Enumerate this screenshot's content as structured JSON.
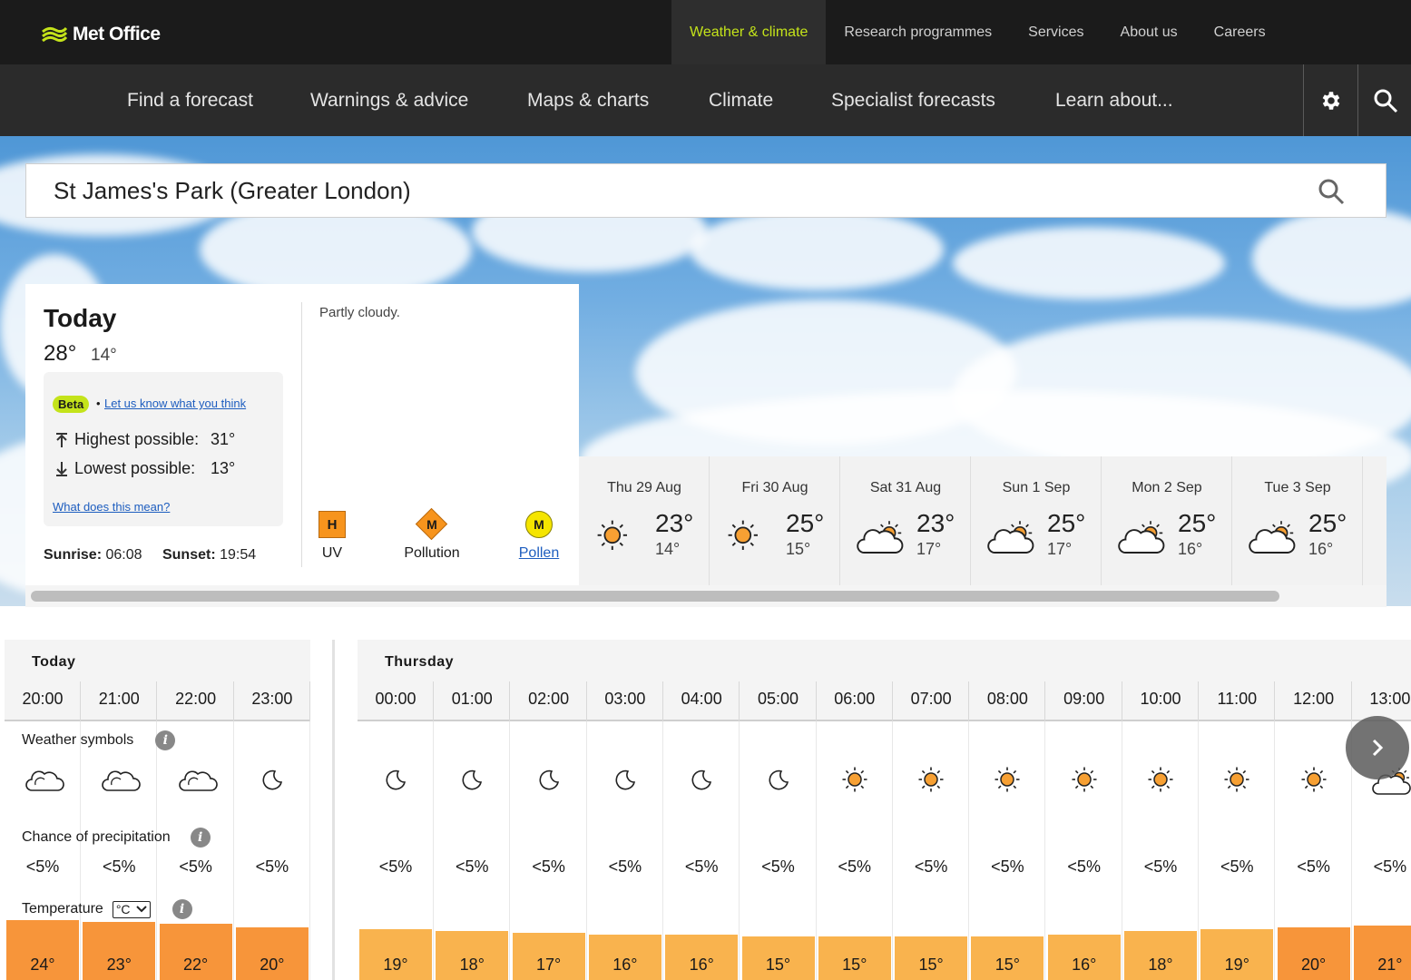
{
  "brand": {
    "name": "Met Office"
  },
  "top_nav": [
    {
      "label": "Weather & climate",
      "active": true
    },
    {
      "label": "Research programmes",
      "active": false
    },
    {
      "label": "Services",
      "active": false
    },
    {
      "label": "About us",
      "active": false
    },
    {
      "label": "Careers",
      "active": false
    }
  ],
  "main_nav": [
    "Find a forecast",
    "Warnings & advice",
    "Maps & charts",
    "Climate",
    "Specialist forecasts",
    "Learn about..."
  ],
  "nav_icons": [
    "gear-icon",
    "search-icon"
  ],
  "search": {
    "value": "St James's Park (Greater London)"
  },
  "today": {
    "title": "Today",
    "high": "28°",
    "low": "14°",
    "beta_badge": "Beta",
    "beta_sep": "•",
    "beta_link": "Let us know what you think",
    "highest_label": "Highest possible:",
    "highest_value": "31°",
    "lowest_label": "Lowest possible:",
    "lowest_value": "13°",
    "what_link": "What does this mean?",
    "sunrise_label": "Sunrise:",
    "sunrise": "06:08",
    "sunset_label": "Sunset:",
    "sunset": "19:54",
    "description": "Partly cloudy.",
    "uv": {
      "label": "UV",
      "level": "H",
      "color": "#f7941d"
    },
    "pollution": {
      "label": "Pollution",
      "level": "M",
      "color": "#f7941d"
    },
    "pollen": {
      "label": "Pollen",
      "level": "M",
      "color": "#f5e500"
    }
  },
  "days": [
    {
      "name": "Thu 29 Aug",
      "icon": "sun",
      "high": "23°",
      "low": "14°"
    },
    {
      "name": "Fri 30 Aug",
      "icon": "sun",
      "high": "25°",
      "low": "15°"
    },
    {
      "name": "Sat 31 Aug",
      "icon": "sun-cloud",
      "high": "23°",
      "low": "17°"
    },
    {
      "name": "Sun 1 Sep",
      "icon": "sun-cloud",
      "high": "25°",
      "low": "17°"
    },
    {
      "name": "Mon 2 Sep",
      "icon": "sun-cloud",
      "high": "25°",
      "low": "16°"
    },
    {
      "name": "Tue 3 Sep",
      "icon": "sun-cloud",
      "high": "25°",
      "low": "16°"
    }
  ],
  "hourly": {
    "labels": {
      "weather": "Weather symbols",
      "precip": "Chance of precipitation",
      "temp": "Temperature",
      "unit": "°C"
    },
    "today": {
      "label": "Today",
      "hours": [
        {
          "time": "20:00",
          "icon": "cloud",
          "precip": "<5%",
          "temp": "24°"
        },
        {
          "time": "21:00",
          "icon": "cloud",
          "precip": "<5%",
          "temp": "23°"
        },
        {
          "time": "22:00",
          "icon": "cloud",
          "precip": "<5%",
          "temp": "22°"
        },
        {
          "time": "23:00",
          "icon": "moon",
          "precip": "<5%",
          "temp": "20°"
        }
      ]
    },
    "thursday": {
      "label": "Thursday",
      "hours": [
        {
          "time": "00:00",
          "icon": "moon",
          "precip": "<5%",
          "temp": "19°"
        },
        {
          "time": "01:00",
          "icon": "moon",
          "precip": "<5%",
          "temp": "18°"
        },
        {
          "time": "02:00",
          "icon": "moon",
          "precip": "<5%",
          "temp": "17°"
        },
        {
          "time": "03:00",
          "icon": "moon",
          "precip": "<5%",
          "temp": "16°"
        },
        {
          "time": "04:00",
          "icon": "moon",
          "precip": "<5%",
          "temp": "16°"
        },
        {
          "time": "05:00",
          "icon": "moon",
          "precip": "<5%",
          "temp": "15°"
        },
        {
          "time": "06:00",
          "icon": "sun",
          "precip": "<5%",
          "temp": "15°"
        },
        {
          "time": "07:00",
          "icon": "sun",
          "precip": "<5%",
          "temp": "15°"
        },
        {
          "time": "08:00",
          "icon": "sun",
          "precip": "<5%",
          "temp": "15°"
        },
        {
          "time": "09:00",
          "icon": "sun",
          "precip": "<5%",
          "temp": "16°"
        },
        {
          "time": "10:00",
          "icon": "sun",
          "precip": "<5%",
          "temp": "18°"
        },
        {
          "time": "11:00",
          "icon": "sun",
          "precip": "<5%",
          "temp": "19°"
        },
        {
          "time": "12:00",
          "icon": "sun",
          "precip": "<5%",
          "temp": "20°"
        },
        {
          "time": "13:00",
          "icon": "sun-cloud",
          "precip": "<5%",
          "temp": "21°"
        }
      ]
    }
  },
  "colors": {
    "accent": "#c4e31a",
    "header": "#1b1b1b",
    "nav": "#2b2b2b",
    "temp_hot": "#f7953a",
    "temp_warm": "#f9b34e",
    "link": "#1d5dbf"
  }
}
